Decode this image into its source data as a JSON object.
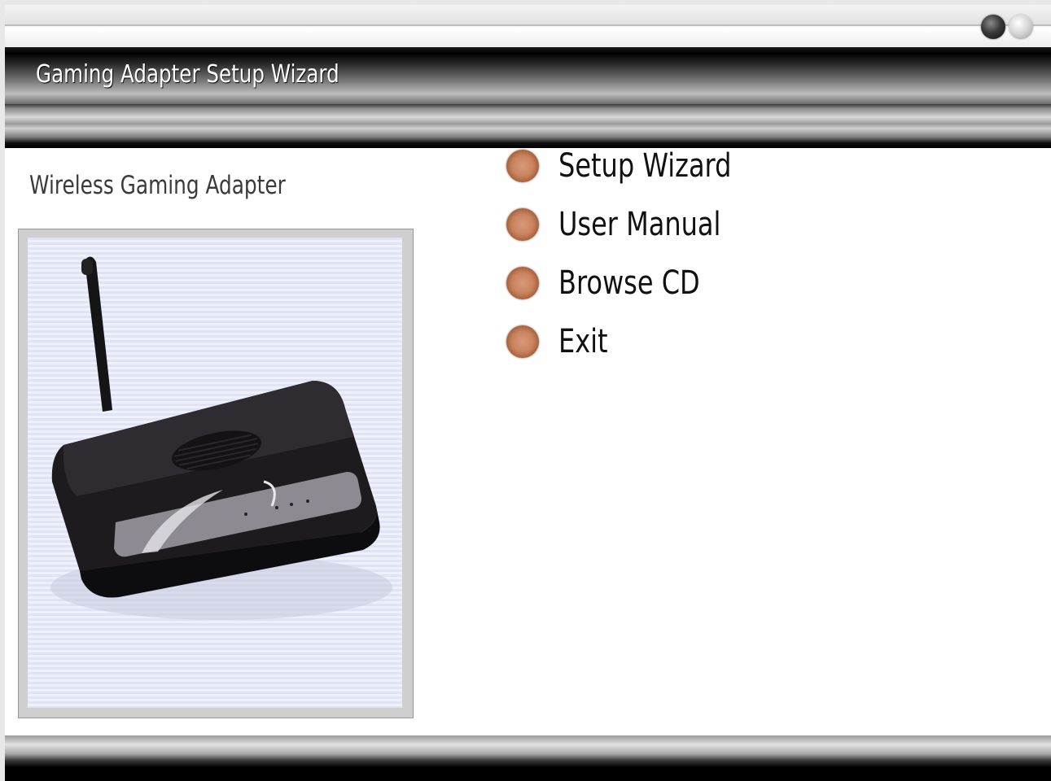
{
  "window": {
    "title": "Gaming Adapter Setup Wizard",
    "controls": [
      "minimize-dot",
      "close-dot"
    ]
  },
  "content": {
    "product_name": "Wireless Gaming Adapter",
    "image_description_icon": "wireless-router-icon"
  },
  "menu": {
    "items": [
      {
        "label": "Setup Wizard"
      },
      {
        "label": "User Manual"
      },
      {
        "label": "Browse CD"
      },
      {
        "label": "Exit"
      }
    ]
  },
  "colors": {
    "bullet": "#c9835e",
    "title_bar": "#000000",
    "photo_background": "#dfe3f3"
  }
}
